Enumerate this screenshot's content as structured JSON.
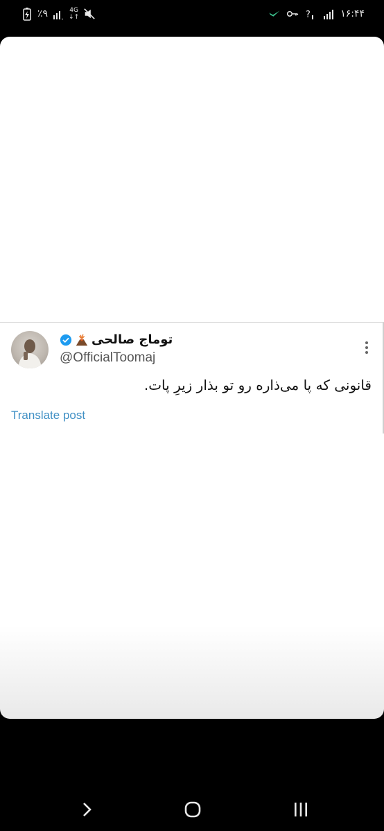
{
  "status_bar": {
    "time": "۱۶:۴۴",
    "battery_percent": "٪۹",
    "network_type": "4G",
    "icons": [
      "battery-charging-icon",
      "signal-icon",
      "network-4g-icon",
      "mute-icon",
      "whatsapp-icon",
      "vpn-key-icon",
      "wifi-question-icon",
      "signal-bars-icon"
    ]
  },
  "tweet": {
    "display_name": "توماج صالحی",
    "name_emoji_icon": "volcano-icon",
    "verified_icon": "verified-badge-icon",
    "handle": "@OfficialToomaj",
    "text": "قانونی که پا می‌ذاره رو تو بذار زیرِ پات.",
    "translate_label": "Translate post",
    "more_icon": "more-vertical-icon"
  },
  "colors": {
    "link": "#3f8fc4",
    "verified": "#1d9bf0",
    "background": "#000000",
    "card": "#ffffff"
  },
  "nav_bar": {
    "icons": [
      "back-chevron-icon",
      "home-circle-icon",
      "recents-icon"
    ]
  }
}
